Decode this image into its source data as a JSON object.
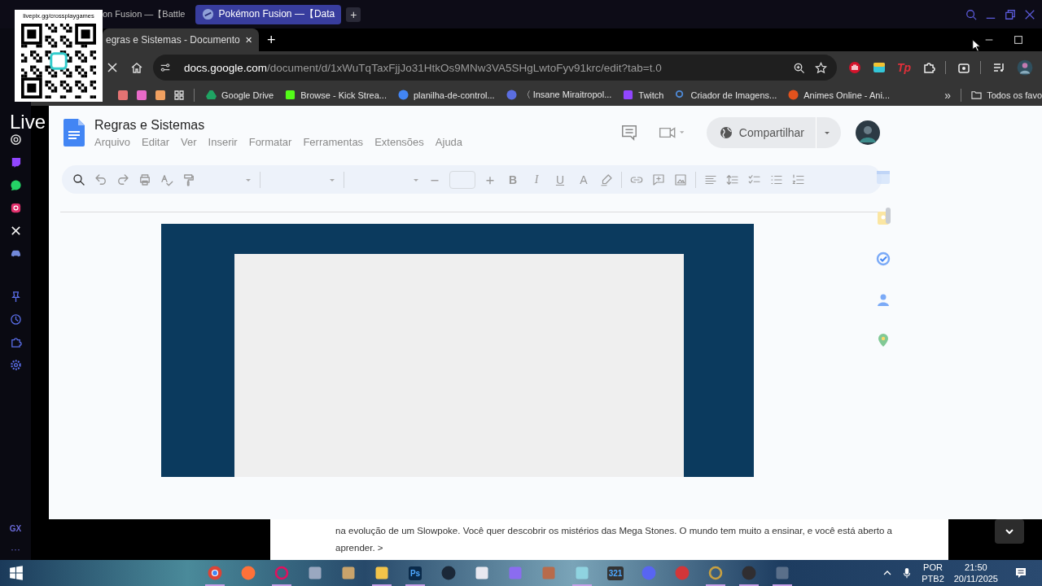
{
  "stream_overlay": {
    "caption": "livepix.gg/crossplaygames",
    "brand": "Live"
  },
  "opera_window": {
    "tabs": [
      {
        "title": "on Fusion —【Battle",
        "selected": false
      },
      {
        "title": "Pokémon Fusion —【Data",
        "selected": true
      }
    ],
    "new_tab": "+",
    "sidebar_footer": {
      "badge": "GX",
      "more": "···"
    }
  },
  "chrome_window": {
    "tab": {
      "title": "egras e Sistemas - Documento",
      "close": "✕"
    },
    "new_tab": "+",
    "address": {
      "host": "docs.google.com",
      "path": "/document/d/1xWuTqTaxFjjJo31HtkOs9MNw3VA5SHgLwtoFyv91krc/edit?tab=t.0"
    },
    "extension_label": "Tp",
    "bookmarks": [
      {
        "kind": "drive",
        "label": "Google Drive"
      },
      {
        "kind": "kick",
        "label": "Browse - Kick Strea..."
      },
      {
        "kind": "google",
        "label": "planilha-de-control..."
      },
      {
        "kind": "game",
        "label": "〈 Insane Miraitropol..."
      },
      {
        "kind": "twitch",
        "label": "Twitch"
      },
      {
        "kind": "search",
        "label": "Criador de Imagens..."
      },
      {
        "kind": "animes",
        "label": "Animes Online - Ani..."
      }
    ],
    "bookmarks_more": "»",
    "all_bookmarks": "Todos os favo"
  },
  "docs": {
    "title": "Regras e Sistemas",
    "menus": [
      "Arquivo",
      "Editar",
      "Ver",
      "Inserir",
      "Formatar",
      "Ferramentas",
      "Extensões",
      "Ajuda"
    ],
    "share": "Compartilhar",
    "format_buttons": [
      "B",
      "I",
      "U",
      "A"
    ]
  },
  "background_page": {
    "lines": [
      "na evolução de um Slowpoke. Você quer descobrir os mistérios das Mega Stones. O mundo tem muito a ensinar, e você está aberto a",
      "aprender. >"
    ]
  },
  "taskbar": {
    "apps": [
      {
        "kind": "chrome",
        "open": true
      },
      {
        "kind": "firefox",
        "open": false
      },
      {
        "kind": "opera",
        "open": true
      },
      {
        "kind": "tool",
        "open": false
      },
      {
        "kind": "paint",
        "open": false
      },
      {
        "kind": "folder",
        "open": true
      },
      {
        "kind": "photoshop",
        "label": "Ps",
        "open": true
      },
      {
        "kind": "steam",
        "open": false
      },
      {
        "kind": "snip",
        "open": false
      },
      {
        "kind": "launcher",
        "open": false
      },
      {
        "kind": "avatar",
        "open": false
      },
      {
        "kind": "notes",
        "open": true
      },
      {
        "kind": "clapper",
        "label": "321",
        "open": false
      },
      {
        "kind": "discord",
        "open": false
      },
      {
        "kind": "riot",
        "open": false
      },
      {
        "kind": "league",
        "open": true
      },
      {
        "kind": "obs",
        "open": true
      },
      {
        "kind": "calculator",
        "open": true
      }
    ],
    "language": "POR",
    "layout": "PTB2",
    "time": "21:50",
    "date": "20/11/2025"
  }
}
